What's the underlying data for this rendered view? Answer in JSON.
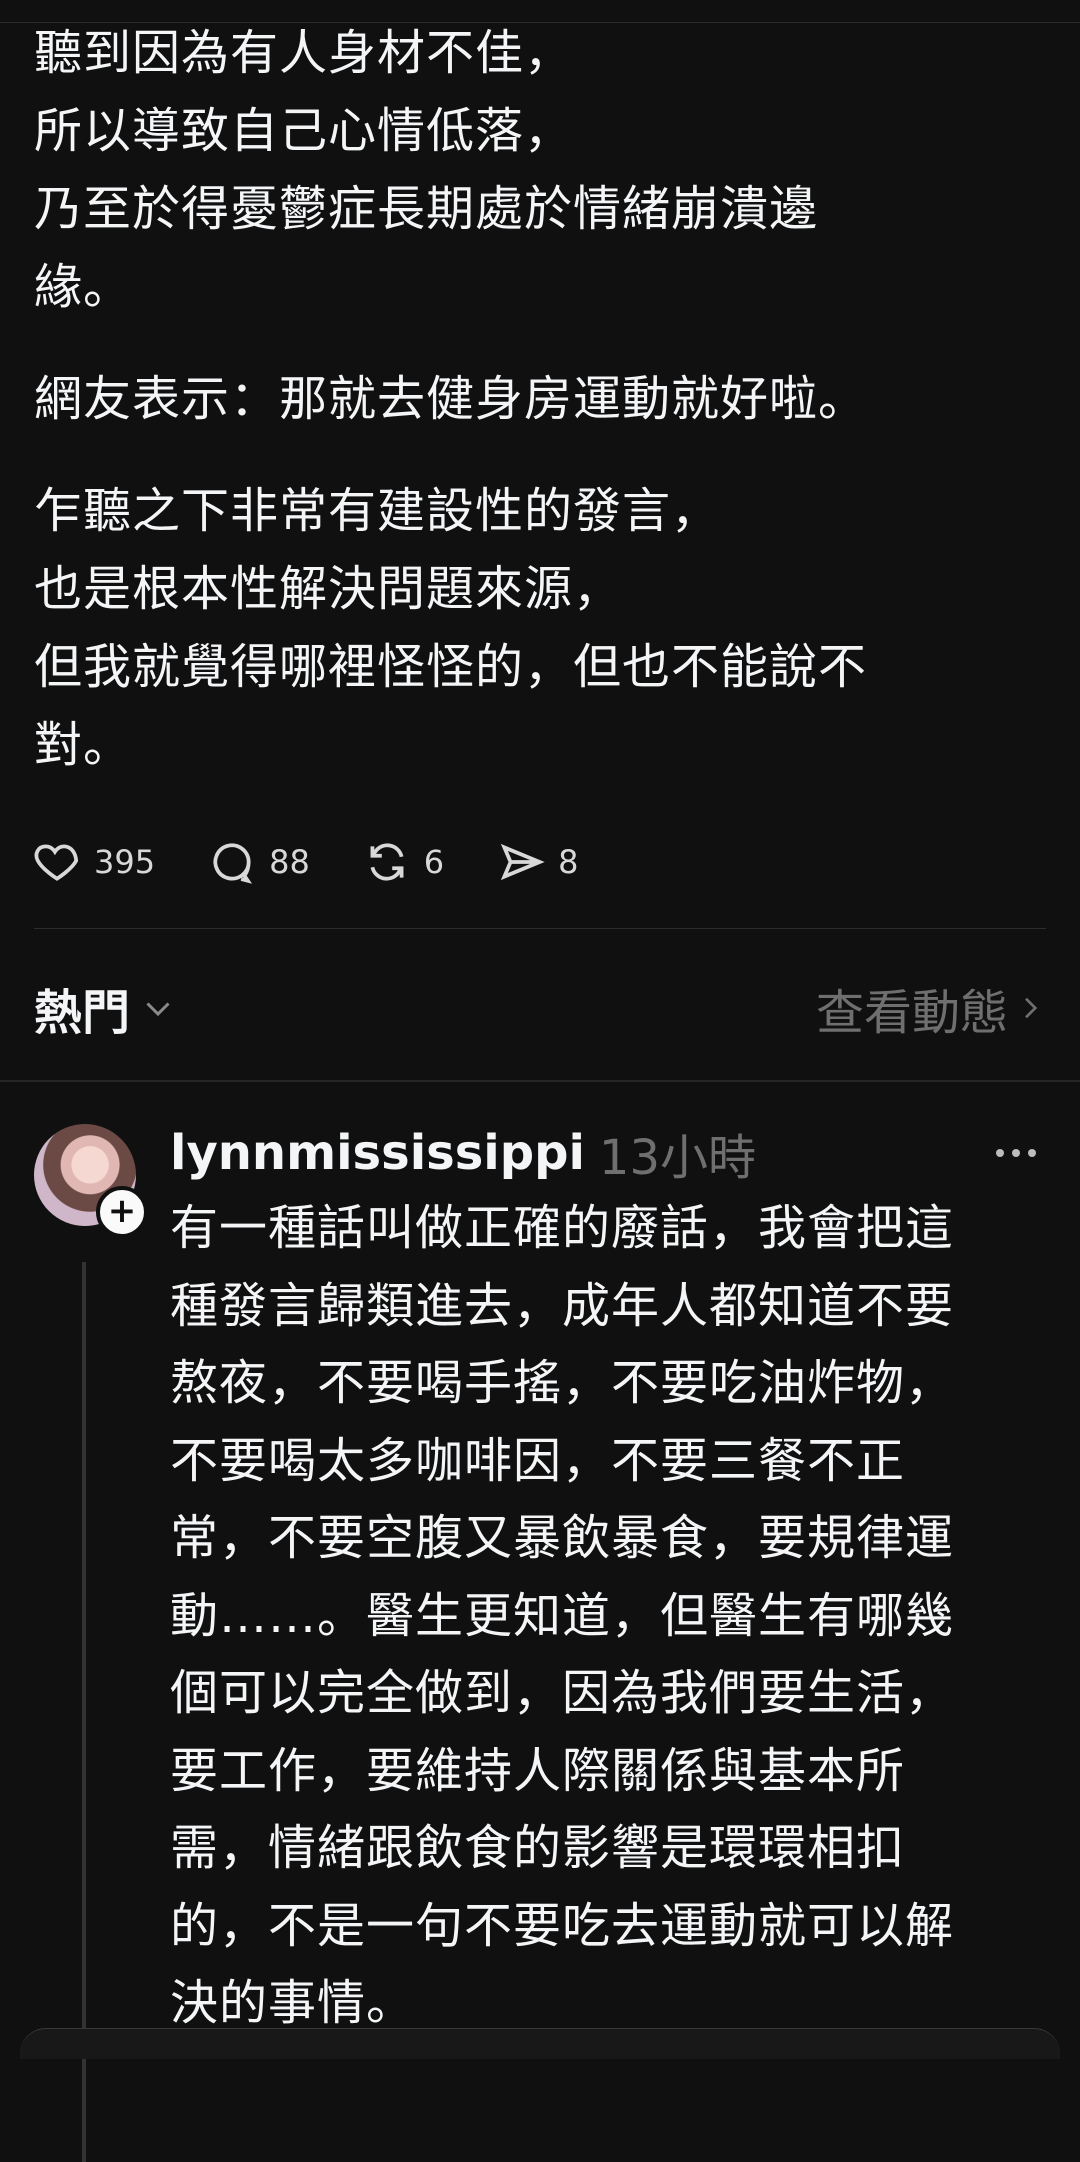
{
  "post": {
    "paragraphs": [
      "聽到因為有人身材不佳，\n所以導致自己心情低落，\n乃至於得憂鬱症長期處於情緒崩潰邊\n緣。",
      "網友表示：那就去健身房運動就好啦。",
      "乍聽之下非常有建設性的發言，\n也是根本性解決問題來源，\n但我就覺得哪裡怪怪的，但也不能說不\n對。"
    ],
    "actions": {
      "likes": "395",
      "comments": "88",
      "reposts": "6",
      "shares": "8"
    }
  },
  "sort": {
    "label": "熱門",
    "view_activity": "查看動態"
  },
  "reply": {
    "username": "lynnmississippi",
    "time": "13小時",
    "text": "有一種話叫做正確的廢話，我會把這\n種發言歸類進去，成年人都知道不要\n熬夜，不要喝手搖，不要吃油炸物，\n不要喝太多咖啡因，不要三餐不正\n常，不要空腹又暴飲暴食，要規律運\n動……。醫生更知道，但醫生有哪幾\n個可以完全做到，因為我們要生活，\n要工作，要維持人際關係與基本所\n需，情緒跟飲食的影響是環環相扣\n的，不是一句不要吃去運動就可以解\n決的事情。"
  },
  "colors": {
    "background": "#101010",
    "text": "#f3f5f7",
    "muted": "#6f6f6f"
  }
}
